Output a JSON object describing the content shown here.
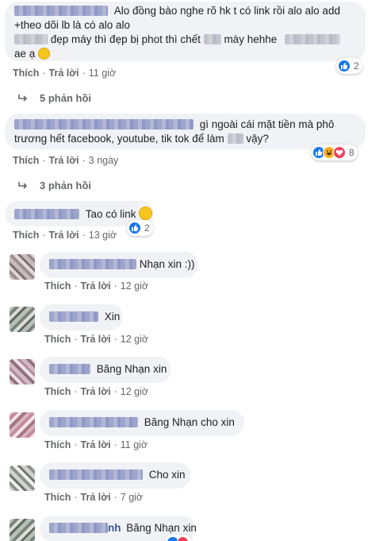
{
  "comments": [
    {
      "lines": [
        "Alo đồng bào nghe rõ hk t có link rồi alo alo add",
        "+theo dõi lb là có alo alo",
        "đẹp máy thì đẹp bị phot thì chết",
        "mày hehhe",
        "ae ạ"
      ],
      "actions": {
        "like": "Thích",
        "reply": "Trả lời",
        "time": "11 giờ"
      },
      "reaction_count": "2",
      "replies_label": "5 phản hồi"
    },
    {
      "lines": [
        "gì ngoài cái mặt tiền mà phô",
        "trương hết facebook, youtube, tik tok để làm",
        "vậy?"
      ],
      "actions": {
        "like": "Thích",
        "reply": "Trả lời",
        "time": "3 ngày"
      },
      "reaction_count": "8",
      "replies_label": "3 phản hồi"
    },
    {
      "text": "Tao có link",
      "actions": {
        "like": "Thích",
        "reply": "Trả lời",
        "time": "13 giờ"
      },
      "reaction_count": "2"
    }
  ],
  "replies": [
    {
      "text": "Nhạn xin :))",
      "actions": {
        "like": "Thích",
        "reply": "Trả lời",
        "time": "12 giờ"
      }
    },
    {
      "text": "Xin",
      "actions": {
        "like": "Thích",
        "reply": "Trả lời",
        "time": "12 giờ"
      }
    },
    {
      "text": "Băng Nhạn xin",
      "actions": {
        "like": "Thích",
        "reply": "Trả lời",
        "time": "12 giờ"
      }
    },
    {
      "text": "Băng Nhạn cho xin",
      "actions": {
        "like": "Thích",
        "reply": "Trả lời",
        "time": "11 giờ"
      }
    },
    {
      "text": "Cho xin",
      "actions": {
        "like": "Thích",
        "reply": "Trả lời",
        "time": "7 giờ"
      }
    },
    {
      "name_tail": "nh",
      "text": "Băng Nhạn xin"
    }
  ],
  "colors": {
    "bubble": "#f0f2f5",
    "meta": "#65676b",
    "like": "#1877f2",
    "haha": "#f7b125",
    "heart": "#f33e58"
  },
  "icons": [
    "reply-arrow-icon",
    "like-reaction-icon",
    "haha-reaction-icon",
    "heart-reaction-icon",
    "smile-emoji-icon"
  ]
}
